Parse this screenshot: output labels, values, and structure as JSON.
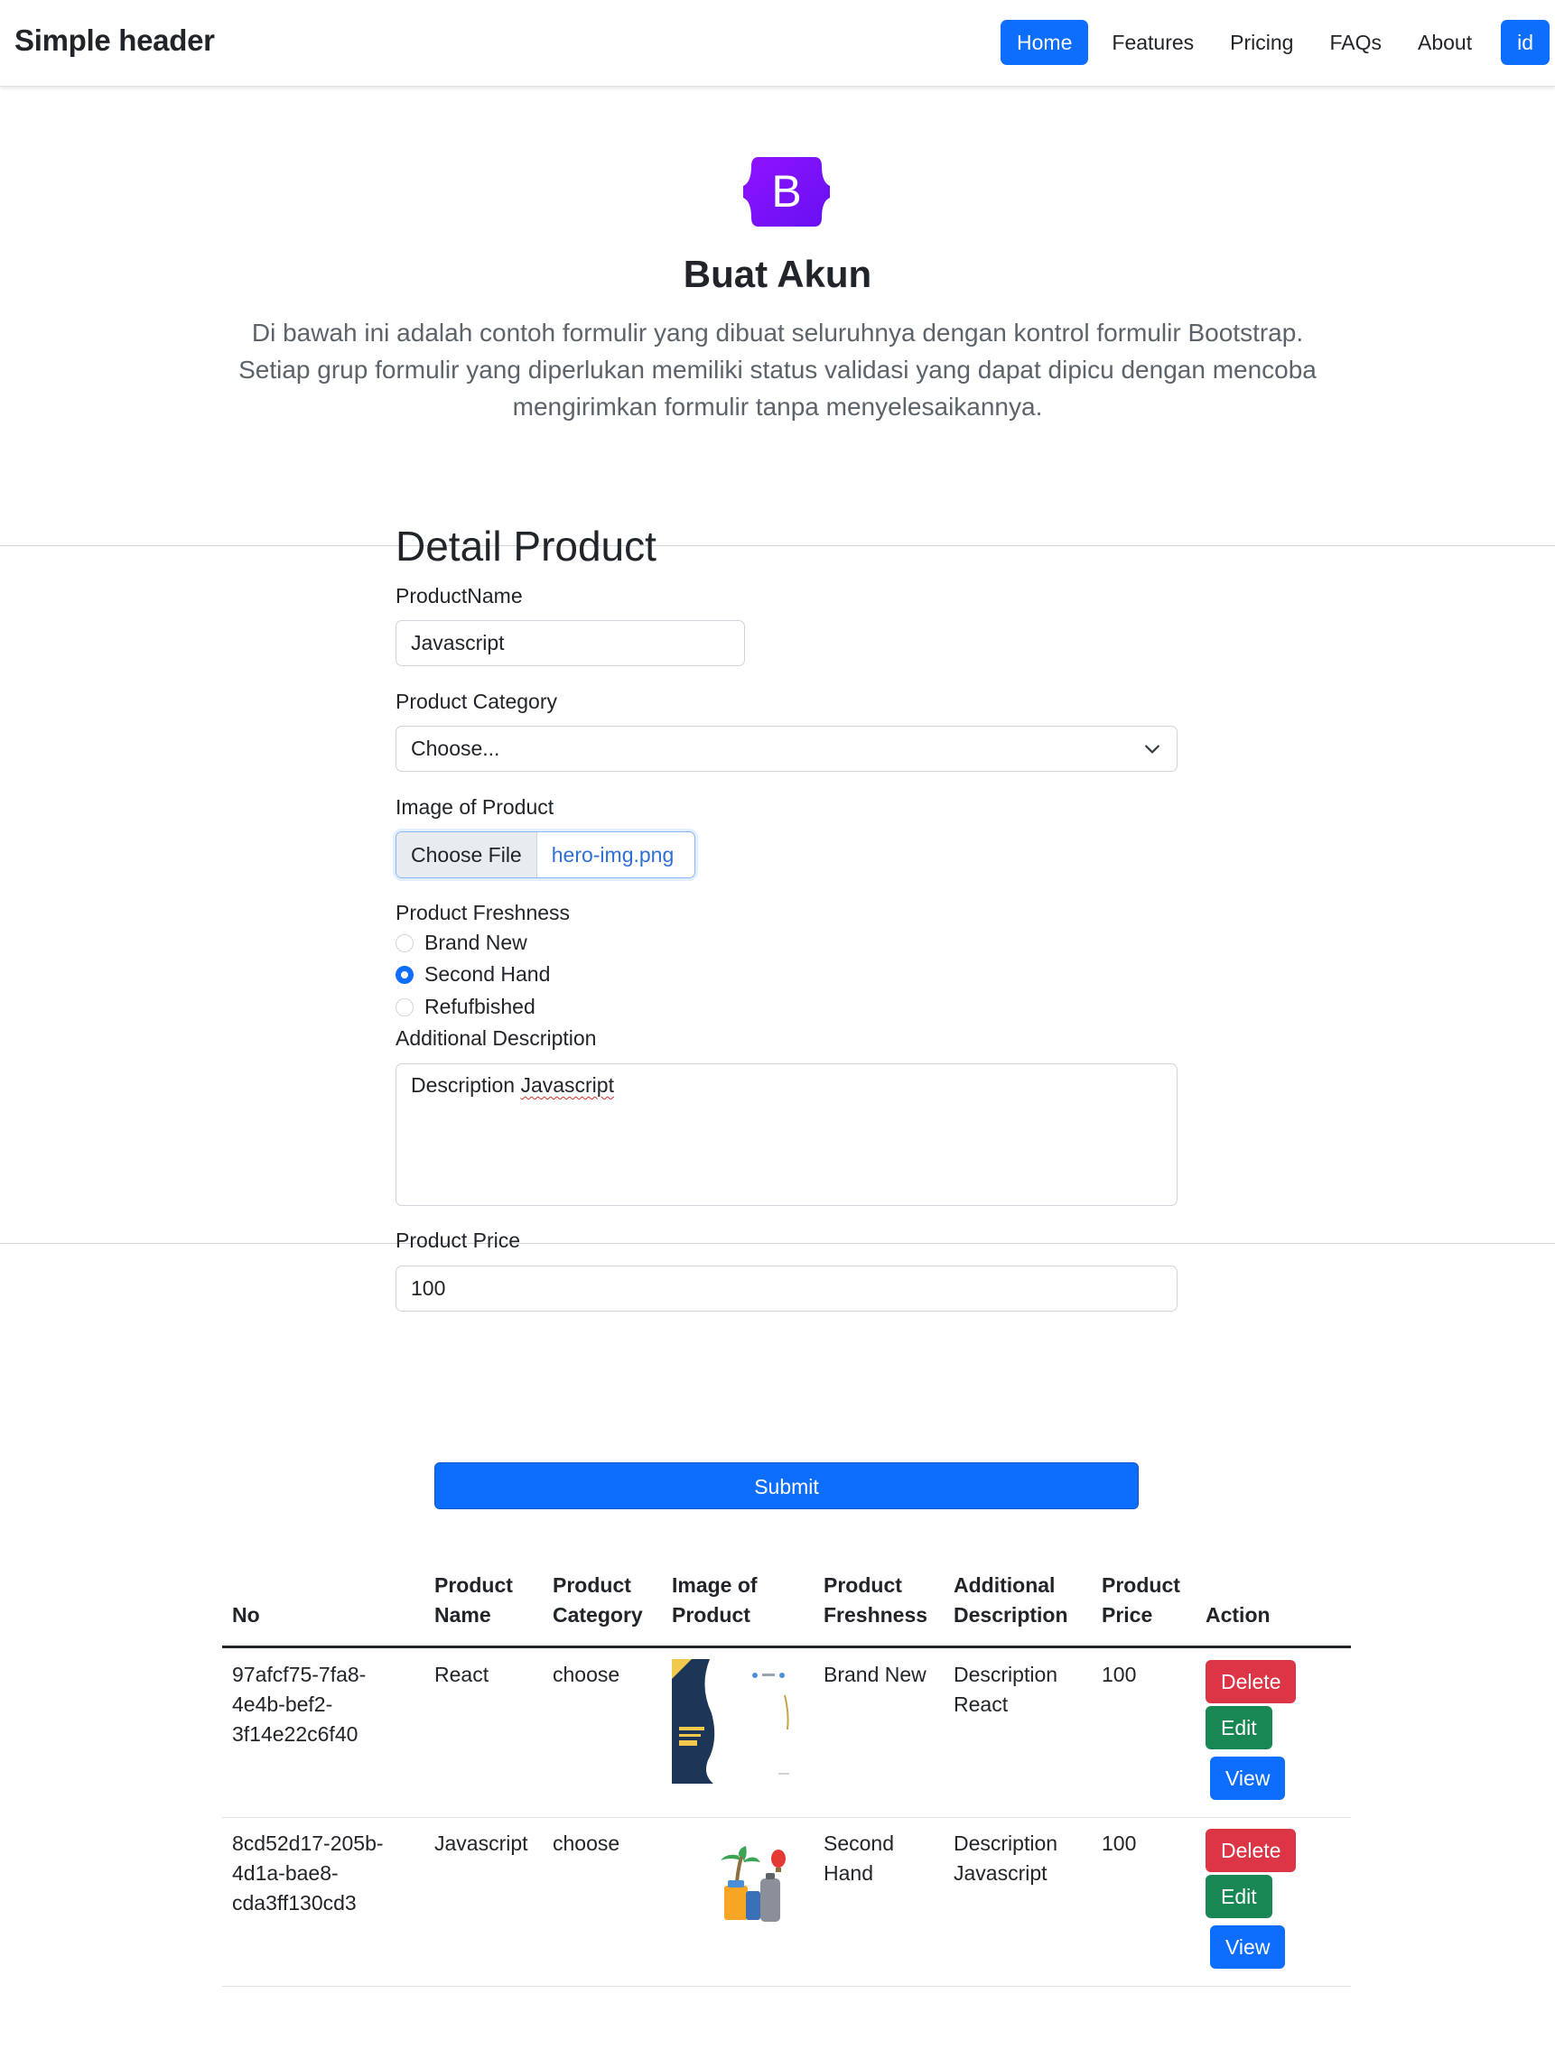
{
  "header": {
    "brand": "Simple header",
    "nav": [
      "Home",
      "Features",
      "Pricing",
      "FAQs",
      "About"
    ],
    "lang_button": "id"
  },
  "hero": {
    "logo_letter": "B",
    "title": "Buat Akun",
    "lead": "Di bawah ini adalah contoh formulir yang dibuat seluruhnya dengan kontrol formulir Bootstrap. Setiap grup formulir yang diperlukan memiliki status validasi yang dapat dipicu dengan mencoba mengirimkan formulir tanpa menyelesaikannya."
  },
  "form": {
    "title": "Detail Product",
    "product_name_label": "ProductName",
    "product_name_value": "Javascript",
    "category_label": "Product Category",
    "category_selected": "Choose...",
    "image_label": "Image of Product",
    "file_button": "Choose File",
    "file_name": "hero-img.png",
    "freshness_label": "Product Freshness",
    "freshness_options": [
      "Brand New",
      "Second Hand",
      "Refufbished"
    ],
    "freshness_selected": "Second Hand",
    "description_label": "Additional Description",
    "description_value_1": "Description ",
    "description_value_2": "Javascript",
    "price_label": "Product Price",
    "price_value": "100",
    "submit_label": "Submit"
  },
  "table": {
    "headers": [
      [
        "No",
        ""
      ],
      [
        "Product",
        "Name"
      ],
      [
        "Product",
        "Category"
      ],
      [
        "Image of",
        "Product"
      ],
      [
        "Product",
        "Freshness"
      ],
      [
        "Additional",
        "Description"
      ],
      [
        "Product",
        "Price"
      ],
      [
        "Action",
        ""
      ]
    ],
    "rows": [
      {
        "no_lines": [
          "97afcf75-7fa8-",
          "4e4b-bef2-",
          "3f14e22c6f40"
        ],
        "name": "React",
        "category": "choose",
        "freshness_lines": [
          "Brand New"
        ],
        "description_lines": [
          "Description",
          "React"
        ],
        "price": "100"
      },
      {
        "no_lines": [
          "8cd52d17-205b-",
          "4d1a-bae8-",
          "cda3ff130cd3"
        ],
        "name": "Javascript",
        "category": "choose",
        "freshness_lines": [
          "Second",
          "Hand"
        ],
        "description_lines": [
          "Description",
          "Javascript"
        ],
        "price": "100"
      }
    ],
    "actions": [
      "Delete",
      "Edit",
      "View"
    ]
  },
  "colors": {
    "primary": "#0d6efd",
    "danger": "#dc3545",
    "success": "#198754",
    "bootstrap_purple": "#7952f3"
  }
}
